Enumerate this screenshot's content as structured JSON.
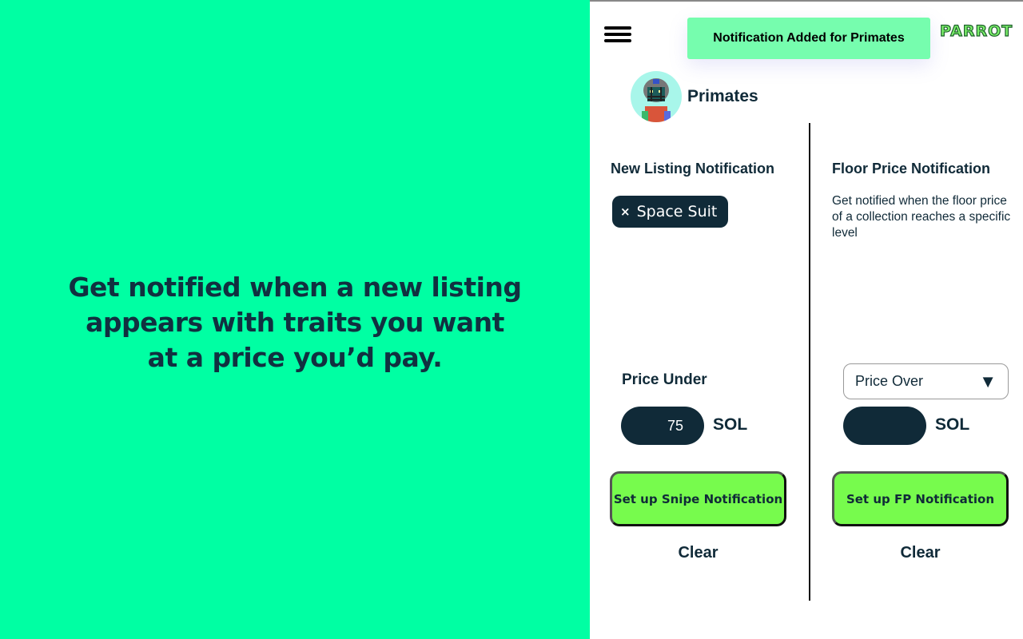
{
  "promo": {
    "headline_lines": [
      "Get notified when a new listing",
      "appears with traits you want",
      "at a price you’d pay."
    ]
  },
  "header": {
    "toast": "Notification Added for Primates",
    "logo": "PARROT"
  },
  "collection": {
    "name": "Primates"
  },
  "new_listing": {
    "title": "New Listing Notification",
    "traits": [
      {
        "label": "Space Suit",
        "remove_icon": "×"
      }
    ],
    "price_label": "Price Under",
    "price_value": "75",
    "unit": "SOL",
    "submit_label": "Set up Snipe Notification",
    "clear_label": "Clear"
  },
  "floor_price": {
    "title": "Floor Price Notification",
    "description": "Get notified when the floor price of a collection reaches a specific level",
    "condition_selected": "Price Over",
    "price_value": "",
    "unit": "SOL",
    "submit_label": "Set up FP Notification",
    "clear_label": "Clear"
  },
  "colors": {
    "promo_bg": "#00ffa3",
    "toast_bg": "#76fdae",
    "button_bg": "#77fb4d",
    "dark": "#102a38"
  }
}
